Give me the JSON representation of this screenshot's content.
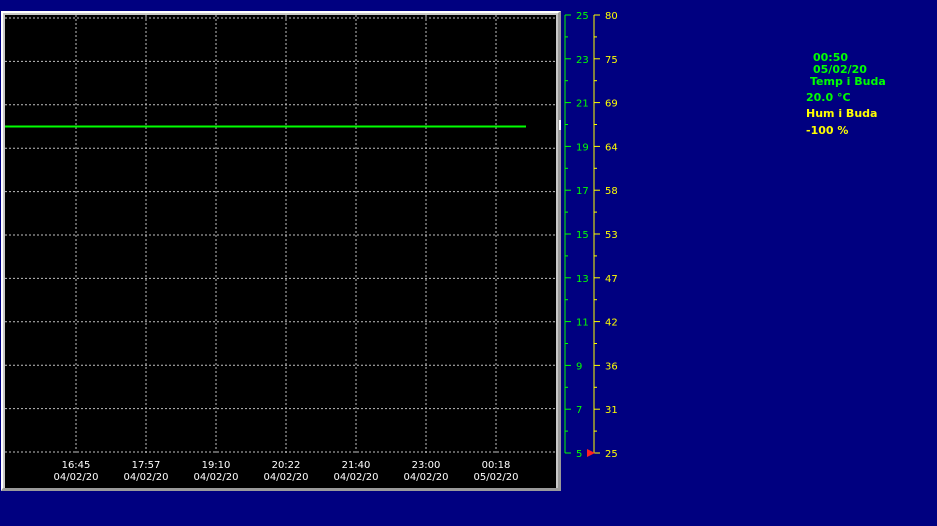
{
  "chart_data": {
    "type": "line",
    "x": [
      "16:45 04/02/20",
      "17:57 04/02/20",
      "19:10 04/02/20",
      "20:22 04/02/20",
      "21:40 04/02/20",
      "23:00 04/02/20",
      "00:18 05/02/20",
      "00:50 05/02/20"
    ],
    "x_ticks": [
      {
        "time": "16:45",
        "date": "04/02/20"
      },
      {
        "time": "17:57",
        "date": "04/02/20"
      },
      {
        "time": "19:10",
        "date": "04/02/20"
      },
      {
        "time": "20:22",
        "date": "04/02/20"
      },
      {
        "time": "21:40",
        "date": "04/02/20"
      },
      {
        "time": "23:00",
        "date": "04/02/20"
      },
      {
        "time": "00:18",
        "date": "05/02/20"
      }
    ],
    "series": [
      {
        "name": "Temp i Buda",
        "color": "#00ff00",
        "values": [
          20,
          20,
          20,
          20,
          20,
          20,
          20,
          20
        ]
      }
    ],
    "y_left": {
      "ticks": [
        "25",
        "23",
        "21",
        "19",
        "17",
        "15",
        "13",
        "11",
        "9",
        "7",
        "5"
      ],
      "min": 5,
      "max": 25,
      "color": "#00ff00"
    },
    "y_right": {
      "ticks": [
        "80",
        "75",
        "69",
        "64",
        "58",
        "53",
        "47",
        "42",
        "36",
        "31",
        "25"
      ],
      "min": 25,
      "max": 80,
      "color": "#ffff00"
    },
    "grid": true
  },
  "readout": {
    "time": "00:50",
    "date": "05/02/20",
    "temp_label": "Temp i Buda",
    "temp_value": "20.0 °C",
    "hum_label": "Hum i Buda",
    "hum_value": "-100 %"
  }
}
